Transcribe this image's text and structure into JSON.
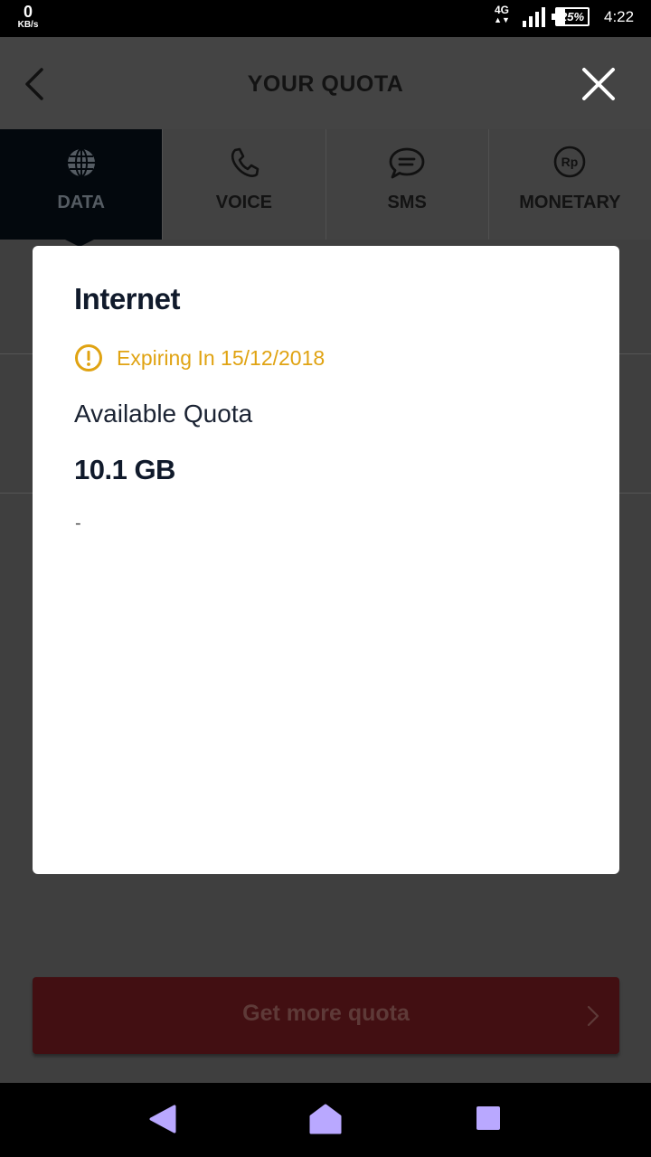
{
  "status_bar": {
    "speed_value": "0",
    "speed_unit": "KB/s",
    "network": "4G",
    "network_arrows": "▲▼",
    "battery": "25%",
    "battery_level": 0.25,
    "time": "4:22"
  },
  "header": {
    "title": "YOUR QUOTA",
    "back_icon": "chevron-left-icon",
    "close_icon": "close-icon"
  },
  "tabs": [
    {
      "label": "DATA",
      "icon": "globe-icon",
      "active": true
    },
    {
      "label": "VOICE",
      "icon": "phone-icon",
      "active": false
    },
    {
      "label": "SMS",
      "icon": "chat-bubble-icon",
      "active": false
    },
    {
      "label": "MONETARY",
      "icon": "rupiah-coin-icon",
      "active": false
    }
  ],
  "modal": {
    "title": "Internet",
    "expiry": "Expiring In 15/12/2018",
    "available_label": "Available Quota",
    "amount": "10.1 GB",
    "note": "-"
  },
  "cta": {
    "label": "Get more quota"
  },
  "colors": {
    "accent_warning": "#e0a312",
    "active_tab": "#03080d",
    "cta_background": "#420f12",
    "nav_buttons": "#b9a8ff"
  }
}
